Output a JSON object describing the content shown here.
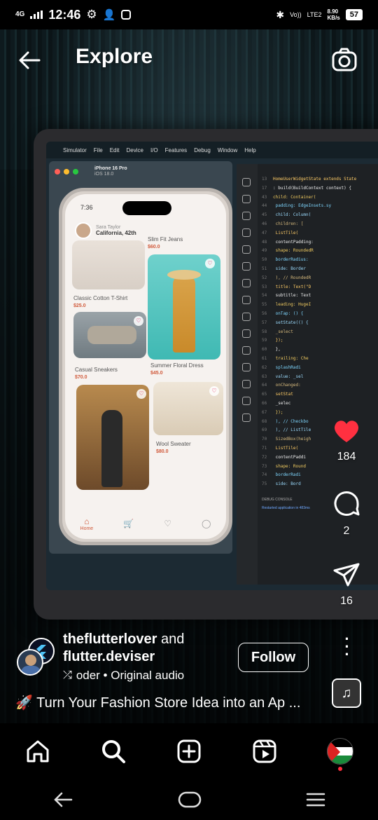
{
  "status_bar": {
    "network": "4G",
    "time": "12:46",
    "volte": "Vo))",
    "lte": "LTE2",
    "speed": "8.90",
    "speed_unit": "KB/s",
    "battery": "57"
  },
  "header": {
    "title": "Explore"
  },
  "video": {
    "mac_menu": [
      "Simulator",
      "File",
      "Edit",
      "Device",
      "I/O",
      "Features",
      "Debug",
      "Window",
      "Help"
    ],
    "simulator_title": "iPhone 16 Pro",
    "simulator_subtitle": "iOS 18.0",
    "phone_time": "7:36",
    "user_name": "Sara Taylor",
    "user_location": "California, 42th",
    "products": [
      {
        "name": "Classic Cotton T-Shirt",
        "price": "$25.0"
      },
      {
        "name": "Slim Fit Jeans",
        "price": "$60.0"
      },
      {
        "name": "Casual Sneakers",
        "price": "$70.0"
      },
      {
        "name": "Summer Floral Dress",
        "price": "$45.0"
      },
      {
        "name": "Wool Sweater",
        "price": "$80.0"
      }
    ],
    "phone_nav_home": "Home",
    "code_lines": [
      {
        "n": "13",
        "t": "HomeUserWidgetState extends State"
      },
      {
        "n": "17",
        "t": ": build(BuildContext context) {"
      },
      {
        "n": "43",
        "t": "child: Container("
      },
      {
        "n": "44",
        "t": "  padding: EdgeInsets.sy"
      },
      {
        "n": "45",
        "t": "  child: Column("
      },
      {
        "n": "46",
        "t": "    children: ["
      },
      {
        "n": "47",
        "t": "      ListTile("
      },
      {
        "n": "48",
        "t": "        contentPadding:"
      },
      {
        "n": "49",
        "t": "        shape: RoundedR"
      },
      {
        "n": "50",
        "t": "          borderRadius:"
      },
      {
        "n": "51",
        "t": "          side: Border"
      },
      {
        "n": "52",
        "t": "        ), // RoundedR"
      },
      {
        "n": "53",
        "t": "        title: Text(\"D"
      },
      {
        "n": "54",
        "t": "        subtitle: Text"
      },
      {
        "n": "55",
        "t": "        leading: HugeI"
      },
      {
        "n": "56",
        "t": "        onTap: () {"
      },
      {
        "n": "57",
        "t": "          setState(() {"
      },
      {
        "n": "58",
        "t": "            _select"
      },
      {
        "n": "59",
        "t": "          });"
      },
      {
        "n": "60",
        "t": "        },"
      },
      {
        "n": "61",
        "t": "        trailing: Che"
      },
      {
        "n": "62",
        "t": "          splashRadi"
      },
      {
        "n": "63",
        "t": "          value: _sel"
      },
      {
        "n": "64",
        "t": "          onChanged:"
      },
      {
        "n": "65",
        "t": "            setStat"
      },
      {
        "n": "66",
        "t": "              _selec"
      },
      {
        "n": "67",
        "t": "            });"
      },
      {
        "n": "68",
        "t": "          ), // Checkbo"
      },
      {
        "n": "69",
        "t": "        ), // ListTile"
      },
      {
        "n": "70",
        "t": "        SizedBox(heigh"
      },
      {
        "n": "71",
        "t": "        ListTile("
      },
      {
        "n": "72",
        "t": "          contentPaddi"
      },
      {
        "n": "73",
        "t": "          shape: Round"
      },
      {
        "n": "74",
        "t": "            borderRadi"
      },
      {
        "n": "75",
        "t": "            side: Bord"
      }
    ],
    "console_tab": "DEBUG CONSOLE",
    "console_text": "Restarted application in 483ms"
  },
  "actions": {
    "likes": "184",
    "comments": "2",
    "shares": "16"
  },
  "post": {
    "author1": "theflutterlover",
    "and_text": "and",
    "author2": "flutter.deviser",
    "audio": "oder • Original audio",
    "follow_label": "Follow",
    "caption_emoji": "🚀",
    "caption": "Turn Your Fashion Store Idea into an Ap ..."
  },
  "colors": {
    "like": "#ff3040",
    "accent": "#d0593a"
  }
}
